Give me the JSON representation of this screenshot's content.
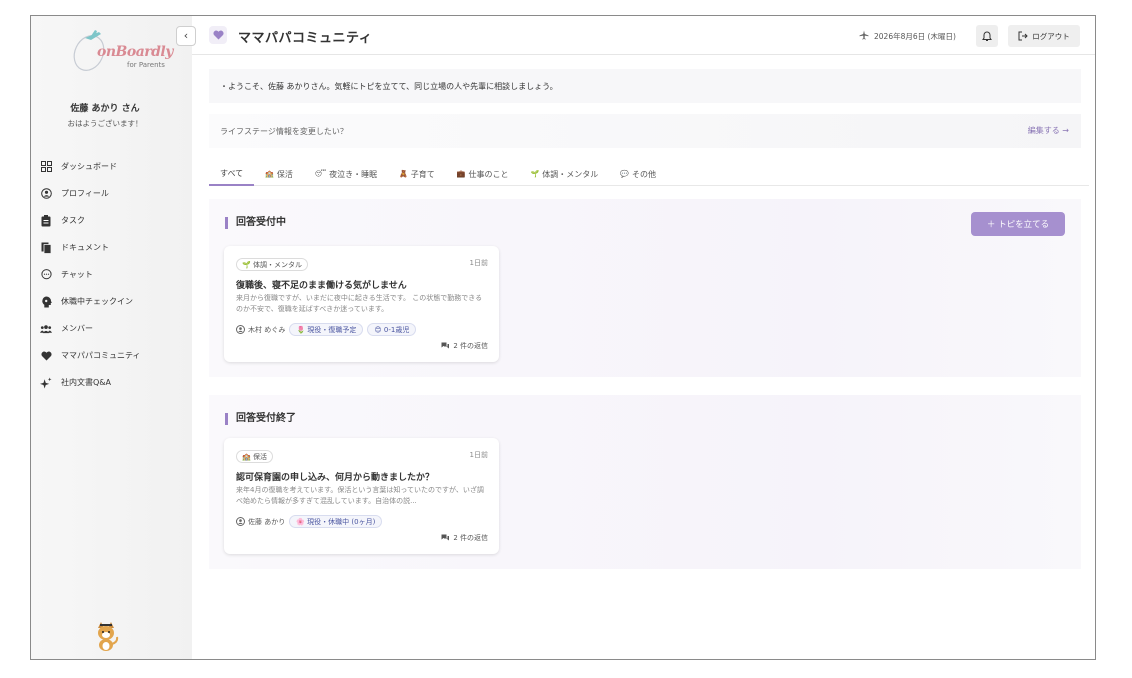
{
  "sidebar": {
    "logo": {
      "text": "onBoardly",
      "sub": "for Parents"
    },
    "user_name": "佐藤 あかり さん",
    "greeting": "おはようございます！",
    "items": [
      {
        "label": "ダッシュボード",
        "icon": "grid-icon"
      },
      {
        "label": "プロフィール",
        "icon": "user-circle-icon"
      },
      {
        "label": "タスク",
        "icon": "clipboard-icon"
      },
      {
        "label": "ドキュメント",
        "icon": "documents-icon"
      },
      {
        "label": "チャット",
        "icon": "chat-icon"
      },
      {
        "label": "休職中チェックイン",
        "icon": "head-icon"
      },
      {
        "label": "メンバー",
        "icon": "users-icon"
      },
      {
        "label": "ママパパコミュニティ",
        "icon": "heart-icon"
      },
      {
        "label": "社内文書Q&A",
        "icon": "sparkle-icon"
      }
    ]
  },
  "header": {
    "title": "ママパパコミュニティ",
    "date": "2026年8月6日 (木曜日)",
    "logout_label": "ログアウト"
  },
  "welcome": "・ようこそ、佐藤 あかりさん。気軽にトピを立てて、同じ立場の人や先輩に相談しましょう。",
  "lifestage": {
    "prompt": "ライフステージ情報を変更したい？",
    "link": "編集する →"
  },
  "tabs": [
    {
      "label": "すべて",
      "icon": ""
    },
    {
      "label": "保活",
      "icon": "🏫"
    },
    {
      "label": "夜泣き・睡眠",
      "icon": "😴"
    },
    {
      "label": "子育て",
      "icon": "🧸"
    },
    {
      "label": "仕事のこと",
      "icon": "💼"
    },
    {
      "label": "体調・メンタル",
      "icon": "🌱"
    },
    {
      "label": "その他",
      "icon": "💬"
    }
  ],
  "sections": {
    "open": {
      "title": "回答受付中",
      "new_topic_label": "＋ トピを立てる",
      "card": {
        "category": "🌱 体調・メンタル",
        "ago": "1日前",
        "title": "復職後、寝不足のまま働ける気がしません",
        "excerpt": "来月から復職ですが、いまだに夜中に起きる生活です。 この状態で勤務できるのか不安で、復職を延ばすべきか迷っています。",
        "author": "木村 めぐみ",
        "chips": [
          "🌷 現役・復職予定",
          "😊 0-1歳児"
        ],
        "replies": "2 件の返信"
      }
    },
    "closed": {
      "title": "回答受付終了",
      "card": {
        "category": "🏫 保活",
        "ago": "1日前",
        "title": "認可保育園の申し込み、何月から動きましたか？",
        "excerpt": "来年4月の復職を考えています。保活という言葉は知っていたのですが、いざ調べ始めたら情報が多すぎて混乱しています。自治体の説...",
        "author": "佐藤 あかり",
        "chips": [
          "🌸 現役・休職中 (0ヶ月)"
        ],
        "replies": "2 件の返信"
      }
    }
  },
  "colors": {
    "accent": "#9a82c6",
    "button": "#a690cf"
  }
}
